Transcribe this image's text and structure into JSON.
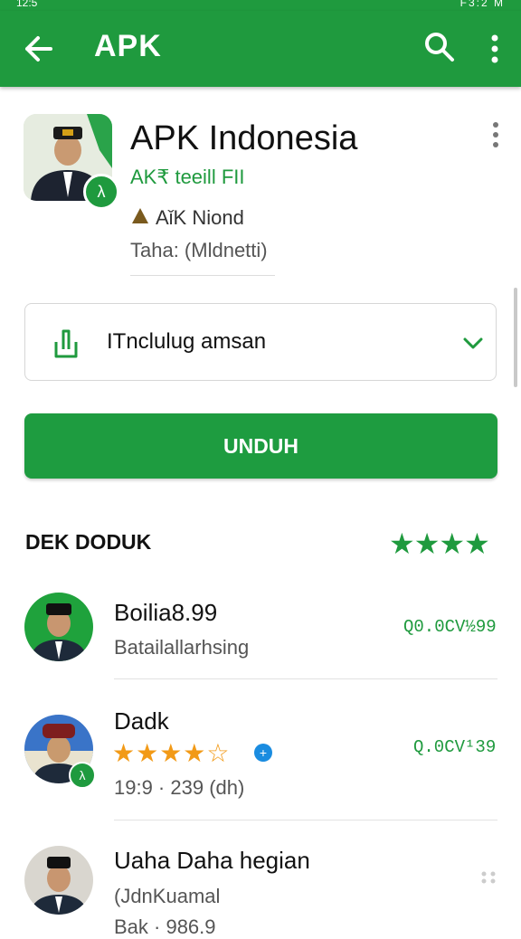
{
  "status_bar": {
    "time": "12:5",
    "right_text": "F3:2 M"
  },
  "app_bar": {
    "title": "APK",
    "back_icon": "arrow-left-icon",
    "search_icon": "search-icon",
    "more_icon": "more-vert-icon",
    "color": "#1f9a3e"
  },
  "app": {
    "name": "APK Indonesia",
    "developer": "AK₹ teeill FII",
    "category": "AǐK Niond",
    "size": "Taha: (Mldnetti)",
    "badge_glyph": "λ"
  },
  "dropdown": {
    "label": "ITnclulug amsan",
    "icon": "download-hand-icon",
    "chevron": "chevron-down-icon"
  },
  "download_button": {
    "label": "UNDUH",
    "color": "#1e9c40"
  },
  "section": {
    "title": "DEK DODUK",
    "stars": "★★★★"
  },
  "list": [
    {
      "title": "Boilia8.99",
      "subtitle": "Batailallarhsing",
      "price": "Q0.0CV½99"
    },
    {
      "title": "Dadk",
      "stars": "★★★★☆",
      "meta": "19:9 · 239 (dh)",
      "price": "Q.0CV¹39"
    },
    {
      "title": "Uaha Daha hegian",
      "subtitle": "(JdnKuamal",
      "extra": "Bak · 986.9"
    }
  ]
}
